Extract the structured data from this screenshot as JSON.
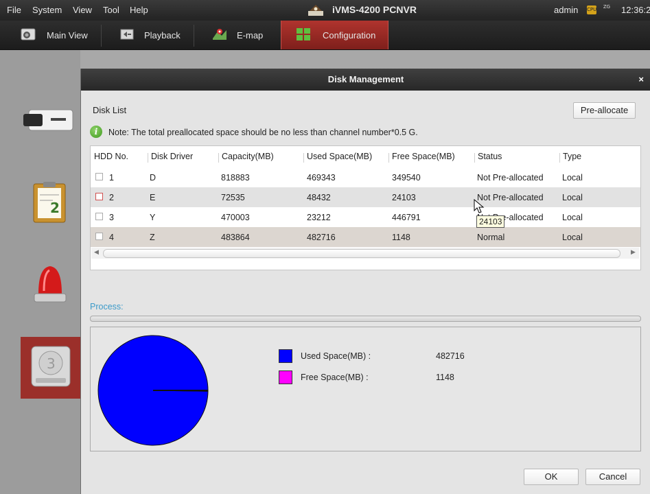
{
  "menubar": {
    "items": [
      "File",
      "System",
      "View",
      "Tool",
      "Help"
    ],
    "app_title": "iVMS-4200  PCNVR",
    "user": "admin",
    "cpu_label": "CPU",
    "net_label": "ZG",
    "clock": "12:36:2"
  },
  "tabs": [
    {
      "label": "Main View",
      "icon": "main-view-icon"
    },
    {
      "label": "Playback",
      "icon": "playback-icon"
    },
    {
      "label": "E-map",
      "icon": "emap-icon"
    },
    {
      "label": "Configuration",
      "icon": "configuration-icon",
      "active": true
    }
  ],
  "sidebar": {
    "items": [
      {
        "icon": "camera-icon"
      },
      {
        "icon": "clipboard-icon"
      },
      {
        "icon": "alarm-light-icon"
      },
      {
        "icon": "hard-disk-icon",
        "active": true
      }
    ]
  },
  "dialog": {
    "title": "Disk Management",
    "close": "×",
    "disk_list_label": "Disk List",
    "preallocate_label": "Pre-allocate",
    "note": "Note: The total preallocated space should be no less than channel number*0.5 G.",
    "table": {
      "columns": [
        "HDD No.",
        "Disk Driver",
        "Capacity(MB)",
        "Used Space(MB)",
        "Free Space(MB)",
        "Status",
        "Type"
      ],
      "rows": [
        {
          "no": "1",
          "driver": "D",
          "capacity": "818883",
          "used": "469343",
          "free": "349540",
          "status": "Not Pre-allocated",
          "type": "Local"
        },
        {
          "no": "2",
          "driver": "E",
          "capacity": "72535",
          "used": "48432",
          "free": "24103",
          "status": "Not Pre-allocated",
          "type": "Local"
        },
        {
          "no": "3",
          "driver": "Y",
          "capacity": "470003",
          "used": "23212",
          "free": "446791",
          "status": "Not Pre-allocated",
          "type": "Local"
        },
        {
          "no": "4",
          "driver": "Z",
          "capacity": "483864",
          "used": "482716",
          "free": "1148",
          "status": "Normal",
          "type": "Local"
        }
      ]
    },
    "tooltip": "24103",
    "process_label": "Process:",
    "legend": [
      {
        "label": "Used Space(MB) :",
        "value": "482716",
        "color": "#0000ff"
      },
      {
        "label": "Free Space(MB) :",
        "value": "1148",
        "color": "#ff00ff"
      }
    ],
    "ok_label": "OK",
    "cancel_label": "Cancel"
  },
  "chart_data": {
    "type": "pie",
    "labels": [
      "Used Space(MB)",
      "Free Space(MB)"
    ],
    "values": [
      482716,
      1148
    ],
    "colors": [
      "#0000ff",
      "#ff00ff"
    ]
  }
}
